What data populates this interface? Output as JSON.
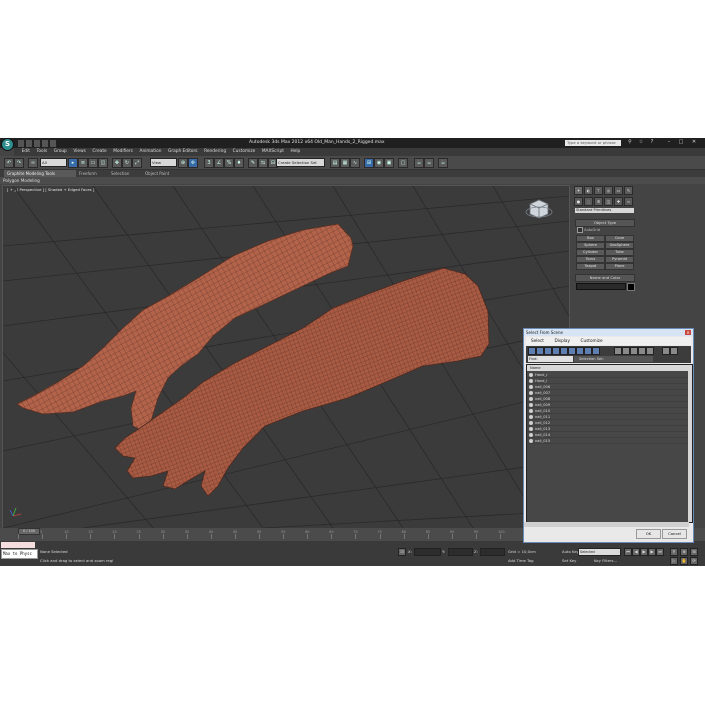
{
  "app": {
    "title": "Autodesk 3ds Max  2012 x64      Old_Man_Hands_2_Rigged.max",
    "logo": "S",
    "search_placeholder": "Type a keyword or phrase"
  },
  "menu": [
    "Edit",
    "Tools",
    "Group",
    "Views",
    "Create",
    "Modifiers",
    "Animation",
    "Graph Editors",
    "Rendering",
    "Customize",
    "MAXScript",
    "Help"
  ],
  "toolbar": {
    "selection_filter": "All",
    "reference_coord": "View",
    "named_selection": "Create Selection Set"
  },
  "ribbon": {
    "tabs": [
      "Graphite Modeling Tools",
      "Freeform",
      "Selection",
      "Object Paint"
    ],
    "sub_label": "Polygon Modeling"
  },
  "viewport": {
    "label": "[ + ] [ Perspective ] [ Shaded + Edged Faces ]"
  },
  "command_panel": {
    "category": "Standard Primitives",
    "object_type_title": "Object Type",
    "autogrid": "AutoGrid",
    "buttons": [
      "Box",
      "Cone",
      "Sphere",
      "GeoSphere",
      "Cylinder",
      "Tube",
      "Torus",
      "Pyramid",
      "Teapot",
      "Plane"
    ],
    "name_color_title": "Name and Color"
  },
  "dialog": {
    "title": "Select From Scene",
    "menu": [
      "Select",
      "Display",
      "Customize"
    ],
    "find_label": "Find:",
    "selection_set_label": "Selection Set:",
    "column_header": "Name",
    "rows": [
      "Hand_r",
      "Hand_l",
      "nail_006",
      "nail_007",
      "nail_008",
      "nail_009",
      "nail_010",
      "nail_011",
      "nail_012",
      "nail_013",
      "nail_014",
      "nail_015"
    ],
    "ok": "OK",
    "cancel": "Cancel"
  },
  "timeline": {
    "slider": "0 / 100",
    "ticks": [
      "0",
      "5",
      "10",
      "15",
      "20",
      "25",
      "30",
      "35",
      "40",
      "45",
      "50",
      "55",
      "60",
      "65",
      "70",
      "75",
      "80",
      "85",
      "90",
      "95",
      "100"
    ]
  },
  "status": {
    "maxscript": "Max to Physc",
    "selection": "None Selected",
    "prompt": "Click and drag to select and zoom regi",
    "grid": "Grid = 10,0cm",
    "add_time_tag": "Add Time Tag",
    "auto_key": "Auto Key",
    "selected_value": "Selected",
    "set_key": "Set Key",
    "key_filters": "Key Filters...",
    "x_value": "X:",
    "y_value": "Y:",
    "z_value": "Z:"
  },
  "colors": {
    "skin": "#b3634a",
    "viewport_bg": "#3b3b3b",
    "dialog_header": "#d6e4f4"
  }
}
